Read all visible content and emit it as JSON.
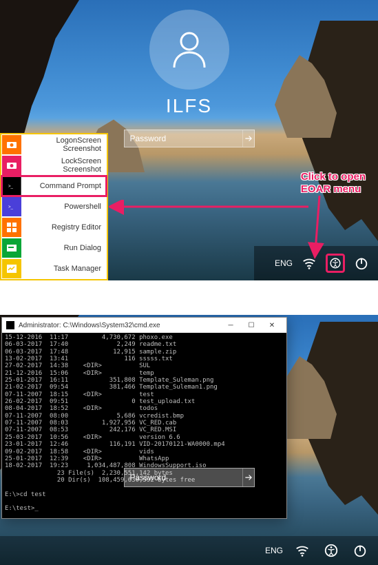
{
  "scene1": {
    "username": "ILFS",
    "password_placeholder": "Password",
    "lang": "ENG",
    "annotation_line1": "Click to open",
    "annotation_line2": "EOAR menu",
    "menu": [
      {
        "label": "LogonScreen Screenshot",
        "icon": "camera-icon",
        "color": "ic-orange"
      },
      {
        "label": "LockScreen Screenshot",
        "icon": "camera-icon",
        "color": "ic-pink"
      },
      {
        "label": "Command Prompt",
        "icon": "terminal-icon",
        "color": "ic-black",
        "highlight": true
      },
      {
        "label": "Powershell",
        "icon": "terminal-icon",
        "color": "ic-purple"
      },
      {
        "label": "Registry Editor",
        "icon": "registry-icon",
        "color": "ic-mosaic"
      },
      {
        "label": "Run Dialog",
        "icon": "run-icon",
        "color": "ic-green"
      },
      {
        "label": "Task Manager",
        "icon": "task-icon",
        "color": "ic-yellow"
      }
    ]
  },
  "scene2": {
    "window_title": "Administrator: C:\\Windows\\System32\\cmd.exe",
    "password_placeholder": "Password",
    "lang": "ENG",
    "cmd_lines": [
      "15-12-2016  11:17         4,730,672 phoxo.exe",
      "06-03-2017  17:40             2,249 readme.txt",
      "06-03-2017  17:48            12,915 sample.zip",
      "13-02-2017  13:41               116 sssss.txt",
      "27-02-2017  14:38    <DIR>          SUL",
      "21-12-2016  15:06    <DIR>          temp",
      "25-01-2017  16:11           351,808 Template_Suleman.png",
      "21-02-2017  09:54           381,466 Template_Suleman1.png",
      "07-11-2007  18:15    <DIR>          test",
      "26-02-2017  09:51                 0 test_upload.txt",
      "08-04-2017  18:52    <DIR>          todos",
      "07-11-2007  08:00             5,686 vcredist.bmp",
      "07-11-2007  08:03         1,927,956 VC_RED.cab",
      "07-11-2007  08:53           242,176 VC_RED.MSI",
      "25-03-2017  10:56    <DIR>          version 6.6",
      "23-01-2017  12:46           116,191 VID-20170121-WA0000.mp4",
      "09-02-2017  18:58    <DIR>          vids",
      "25-01-2017  12:39    <DIR>          WhatsApp",
      "18-02-2017  19:23     1,034,487,808 WindowsSupport.iso",
      "              23 File(s)  2,230,551,142 bytes",
      "              20 Dir(s)  108,459,630,592 bytes free",
      "",
      "E:\\>cd test",
      "",
      "E:\\test>_"
    ]
  }
}
